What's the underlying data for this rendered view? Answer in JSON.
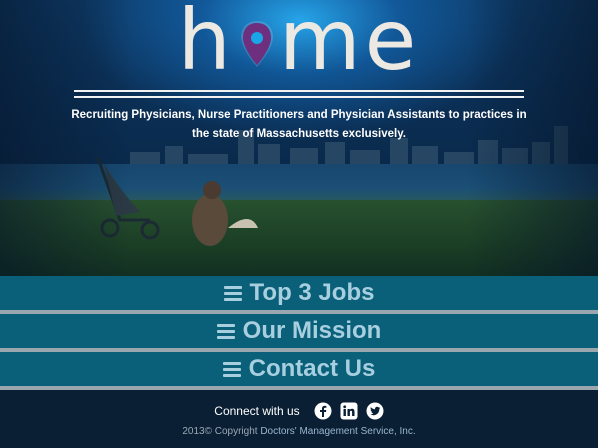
{
  "logo": {
    "text_left": "h",
    "text_right": "me"
  },
  "tagline": "Recruiting Physicians, Nurse Practitioners and Physician Assistants to practices in the state of Massachusetts exclusively.",
  "menu": {
    "items": [
      {
        "label": "Top 3 Jobs"
      },
      {
        "label": "Our Mission"
      },
      {
        "label": "Contact Us"
      }
    ]
  },
  "footer": {
    "connect_label": "Connect with us",
    "social": [
      "facebook-icon",
      "linkedin-icon",
      "twitter-icon"
    ],
    "copyright_prefix": "2013© Copyright",
    "company": "Doctors' Management Service, Inc."
  },
  "colors": {
    "menu_bg": "#0a6078",
    "menu_text": "#a7cfe0",
    "footer_bg": "#0a1f33",
    "pin": "#6d2f7e"
  }
}
